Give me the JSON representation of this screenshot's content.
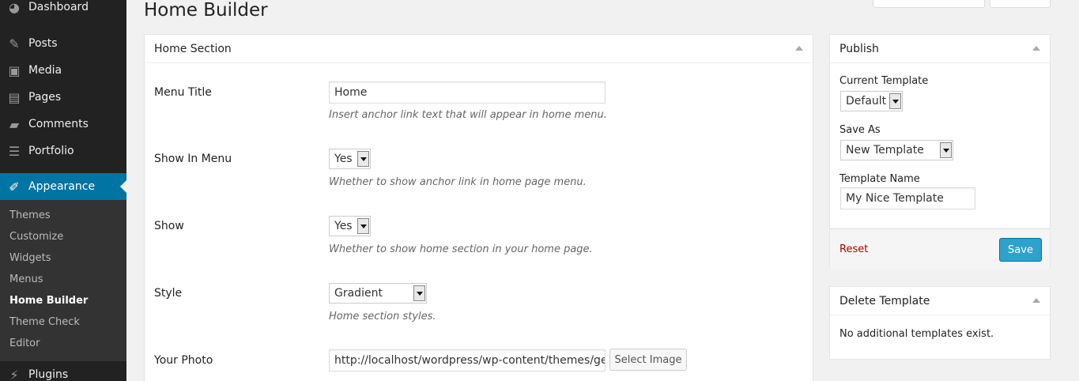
{
  "sidebar": {
    "menu": [
      {
        "label": "Dashboard",
        "icon": "dashboard-icon"
      },
      {
        "label": "Posts",
        "icon": "pin-icon"
      },
      {
        "label": "Media",
        "icon": "media-icon"
      },
      {
        "label": "Pages",
        "icon": "pages-icon"
      },
      {
        "label": "Comments",
        "icon": "comment-icon"
      },
      {
        "label": "Portfolio",
        "icon": "portfolio-icon"
      },
      {
        "label": "Appearance",
        "icon": "brush-icon"
      },
      {
        "label": "Plugins",
        "icon": "plugin-icon"
      }
    ],
    "submenu": [
      "Themes",
      "Customize",
      "Widgets",
      "Menus",
      "Home Builder",
      "Theme Check",
      "Editor"
    ],
    "current_sub": "Home Builder",
    "accent": "#0074a2"
  },
  "page": {
    "title": "Home Builder"
  },
  "home_section": {
    "title": "Home Section",
    "menu_title": {
      "label": "Menu Title",
      "value": "Home",
      "desc": "Insert anchor link text that will appear in home menu."
    },
    "show_in_menu": {
      "label": "Show In Menu",
      "value": "Yes",
      "desc": "Whether to show anchor link in home page menu."
    },
    "show": {
      "label": "Show",
      "value": "Yes",
      "desc": "Whether to show home section in your home page."
    },
    "style": {
      "label": "Style",
      "value": "Gradient",
      "desc": "Home section styles."
    },
    "photo": {
      "label": "Your Photo",
      "value": "http://localhost/wordpress/wp-content/themes/gen",
      "button": "Select Image"
    }
  },
  "publish": {
    "title": "Publish",
    "current_template_label": "Current Template",
    "current_template_value": "Default",
    "save_as_label": "Save As",
    "save_as_value": "New Template",
    "template_name_label": "Template Name",
    "template_name_value": "My Nice Template",
    "reset": "Reset",
    "save": "Save"
  },
  "delete_template": {
    "title": "Delete Template",
    "message": "No additional templates exist."
  }
}
